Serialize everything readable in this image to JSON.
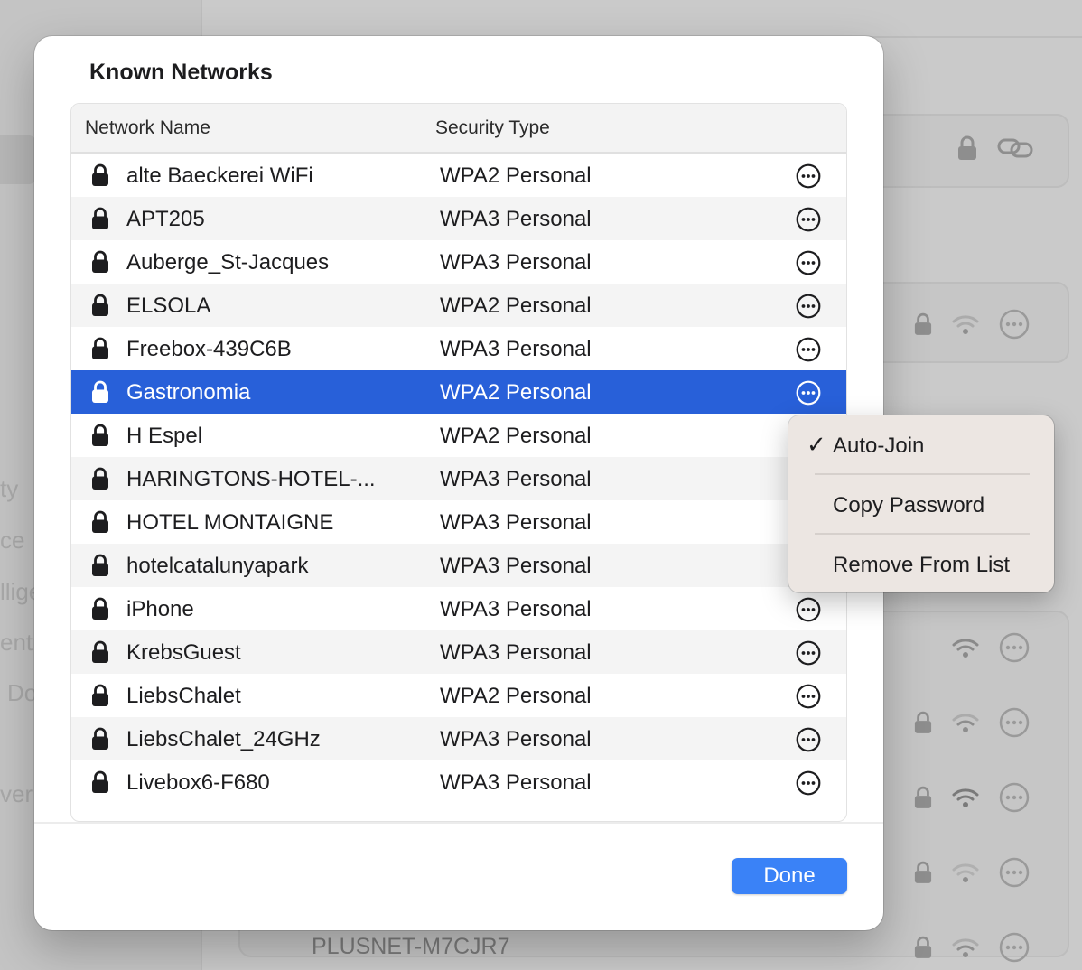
{
  "modal": {
    "title": "Known Networks",
    "columns": {
      "name": "Network Name",
      "security": "Security Type"
    },
    "networks": [
      {
        "name": "alte Baeckerei WiFi",
        "security": "WPA2 Personal"
      },
      {
        "name": "APT205",
        "security": "WPA3 Personal"
      },
      {
        "name": "Auberge_St-Jacques",
        "security": "WPA3 Personal"
      },
      {
        "name": "ELSOLA",
        "security": "WPA2 Personal"
      },
      {
        "name": "Freebox-439C6B",
        "security": "WPA3 Personal"
      },
      {
        "name": "Gastronomia",
        "security": "WPA2 Personal"
      },
      {
        "name": "H Espel",
        "security": "WPA2 Personal"
      },
      {
        "name": "HARINGTONS-HOTEL-...",
        "security": "WPA3 Personal"
      },
      {
        "name": "HOTEL MONTAIGNE",
        "security": "WPA3 Personal"
      },
      {
        "name": "hotelcatalunyapark",
        "security": "WPA3 Personal"
      },
      {
        "name": "iPhone",
        "security": "WPA3 Personal"
      },
      {
        "name": "KrebsGuest",
        "security": "WPA3 Personal"
      },
      {
        "name": "LiebsChalet",
        "security": "WPA2 Personal"
      },
      {
        "name": "LiebsChalet_24GHz",
        "security": "WPA3 Personal"
      },
      {
        "name": "Livebox6-F680",
        "security": "WPA3 Personal"
      }
    ],
    "selected_index": 5,
    "done_label": "Done"
  },
  "context_menu": {
    "checkmark": "✓",
    "items": [
      "Auto-Join",
      "Copy Password",
      "Remove From List"
    ]
  },
  "background": {
    "sidebar_fragments": [
      "ty",
      "ce",
      "llige",
      "entr",
      "Do",
      "ver"
    ],
    "bottom_network": "PLUSNET-M7CJR7"
  },
  "colors": {
    "selection": "#2860d9",
    "done_button": "#3a82f7",
    "menu_bg": "#ece6e2"
  },
  "icons": {
    "row_lock": "lock-icon",
    "row_more": "more-options-icon",
    "bg_lock": "lock-icon",
    "bg_wifi": "wifi-icon",
    "bg_link": "link-icon"
  }
}
